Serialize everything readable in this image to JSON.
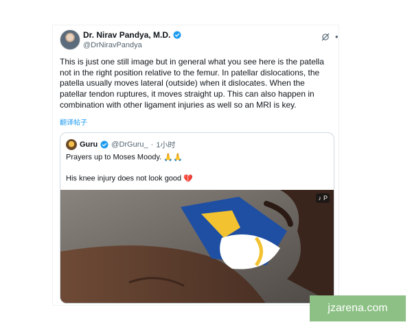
{
  "tweet": {
    "author_name": "Dr. Nirav Pandya, M.D.",
    "author_handle": "@DrNiravPandya",
    "body": "This is just one still image but in general what you see here is the patella not in the right position relative to the femur. In patellar dislocations, the patella usually moves lateral (outside) when it dislocates.  When the patellar tendon ruptures, it moves straight up.  This can also happen in combination with other ligament injuries as well so an MRI is key.",
    "translate_label": "翻译帖子",
    "icons": [
      "verified-badge-icon",
      "grok-icon",
      "more-options-icon"
    ],
    "accent_color": "#1d9bf0"
  },
  "quote": {
    "author_name": "Guru",
    "author_handle": "@DrGuru_",
    "separator": "·",
    "time": "1小时",
    "line1": "Prayers up to Moses Moody.",
    "line1_emoji": "🙏🙏",
    "line2": "His knee injury does not look good",
    "line2_emoji": "💔",
    "media_badge": "P",
    "media_badge_icon": "tiktok-icon"
  },
  "watermark": {
    "text": "jzarena.com",
    "color": "#8cc084"
  }
}
